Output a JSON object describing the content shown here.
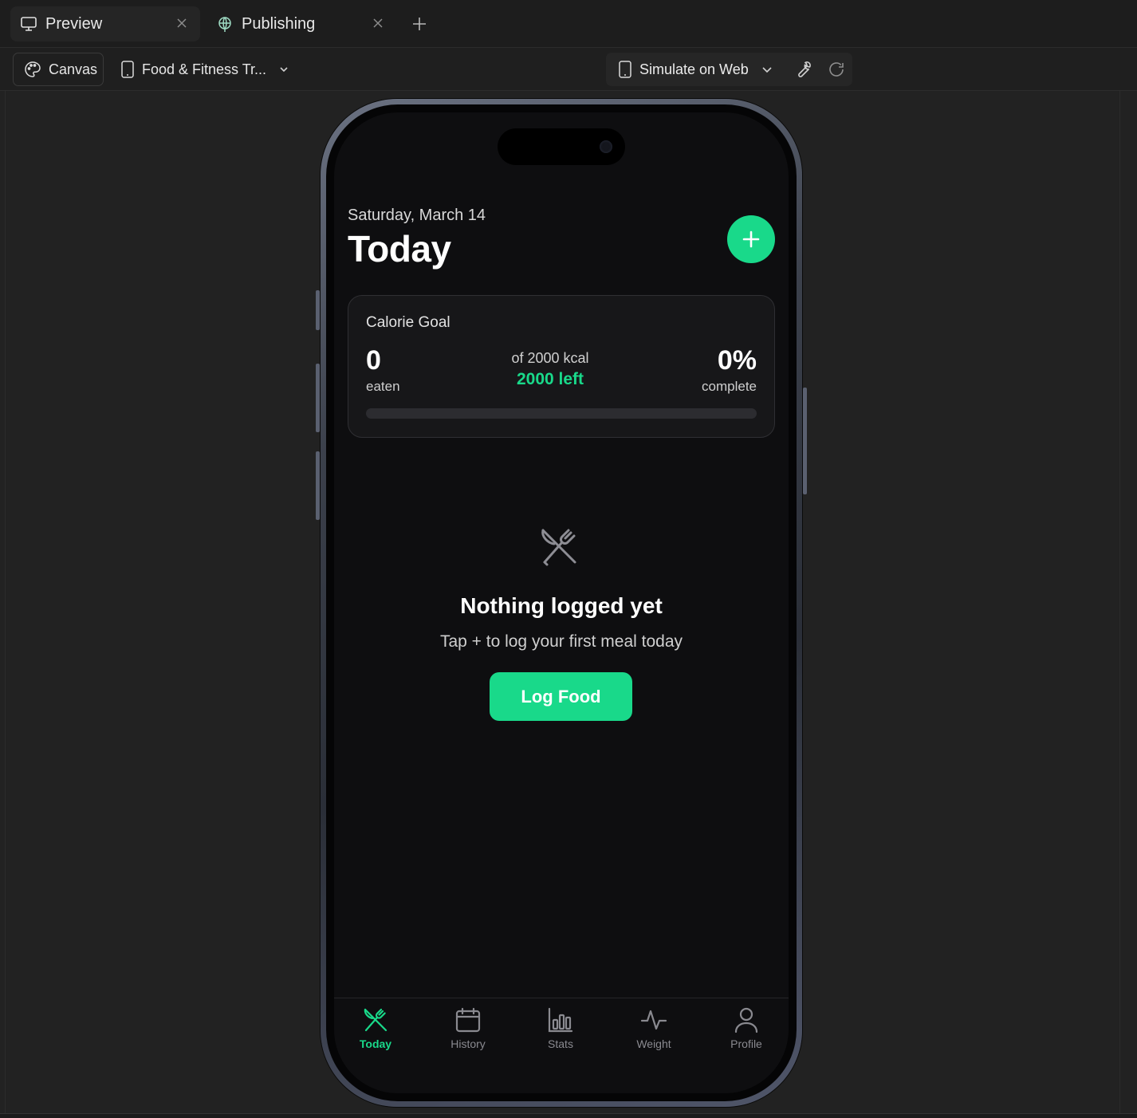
{
  "tabs": [
    {
      "label": "Preview",
      "icon": "monitor-icon",
      "active": true
    },
    {
      "label": "Publishing",
      "icon": "globe-icon",
      "active": false
    }
  ],
  "toolbar": {
    "canvas_label": "Canvas",
    "project_label": "Food & Fitness Tr...",
    "simulate_label": "Simulate on Web"
  },
  "app": {
    "date": "Saturday, March 14",
    "title": "Today",
    "calorie_card": {
      "title": "Calorie Goal",
      "eaten_value": "0",
      "eaten_label": "eaten",
      "goal_text": "of 2000 kcal",
      "left_text": "2000 left",
      "percent_value": "0%",
      "percent_label": "complete",
      "progress_fraction": 0
    },
    "empty_state": {
      "title": "Nothing logged yet",
      "subtitle": "Tap + to log your first meal today",
      "button_label": "Log Food"
    },
    "nav": [
      {
        "label": "Today",
        "icon": "fork-knife-icon",
        "active": true
      },
      {
        "label": "History",
        "icon": "calendar-icon",
        "active": false
      },
      {
        "label": "Stats",
        "icon": "bar-chart-icon",
        "active": false
      },
      {
        "label": "Weight",
        "icon": "pulse-icon",
        "active": false
      },
      {
        "label": "Profile",
        "icon": "user-icon",
        "active": false
      }
    ]
  },
  "colors": {
    "accent": "#19d98a",
    "screen_bg": "#0e0e10",
    "card_bg": "#171719",
    "inactive_nav": "#8a8a90"
  }
}
